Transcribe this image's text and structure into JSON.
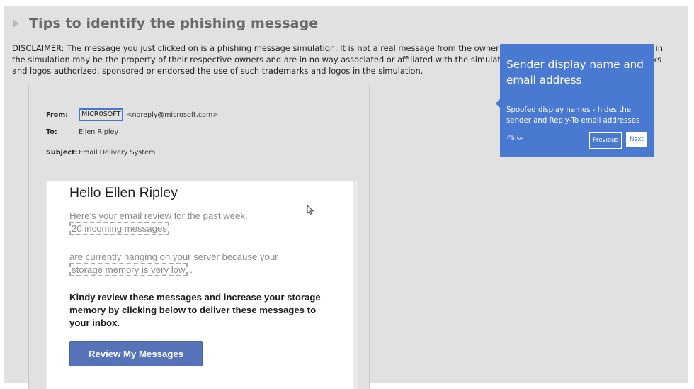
{
  "header": {
    "title": "Tips to identify the phishing message"
  },
  "disclaimer": "DISCLAIMER: The message you just clicked on is a phishing message simulation. It is not a real message from the owner of the trademarks and logos featured in the simulation may be the property of their respective owners and are in no way associated or affiliated with the simulation, and the owners of such trademarks and logos authorized, sponsored or endorsed the use of such trademarks and logos in the simulation.",
  "email": {
    "from_label": "From:",
    "sender_name": "MICR0SOFT",
    "sender_address": "<noreply@microsoft.com>",
    "to_label": "To:",
    "to_value": "Ellen Ripley",
    "subject_label": "Subject:",
    "subject_value": "Email Delivery System",
    "body": {
      "greeting": "Hello Ellen Ripley",
      "intro": "Here's your email review for the past week.",
      "incoming": "20 incoming messages",
      "hanging": "are currently hanging on your server because your",
      "storage": "storage memory is very low",
      "period": ".",
      "instruction": "Kindy review these messages and increase your storage memory by clicking below to deliver these messages to your inbox.",
      "cta_label": "Review My Messages"
    }
  },
  "tooltip": {
    "title": "Sender display name and email address",
    "text": "Spoofed display names - hides the sender and Reply-To email addresses",
    "close_label": "Close",
    "previous_label": "Previous",
    "next_label": "Next"
  },
  "colors": {
    "accent": "#4a79d2",
    "cta": "#5673ba",
    "panel_bg": "#e1e1e1"
  },
  "icons": {
    "header_arrow": "caret-right-icon",
    "pointer": "cursor-icon"
  }
}
